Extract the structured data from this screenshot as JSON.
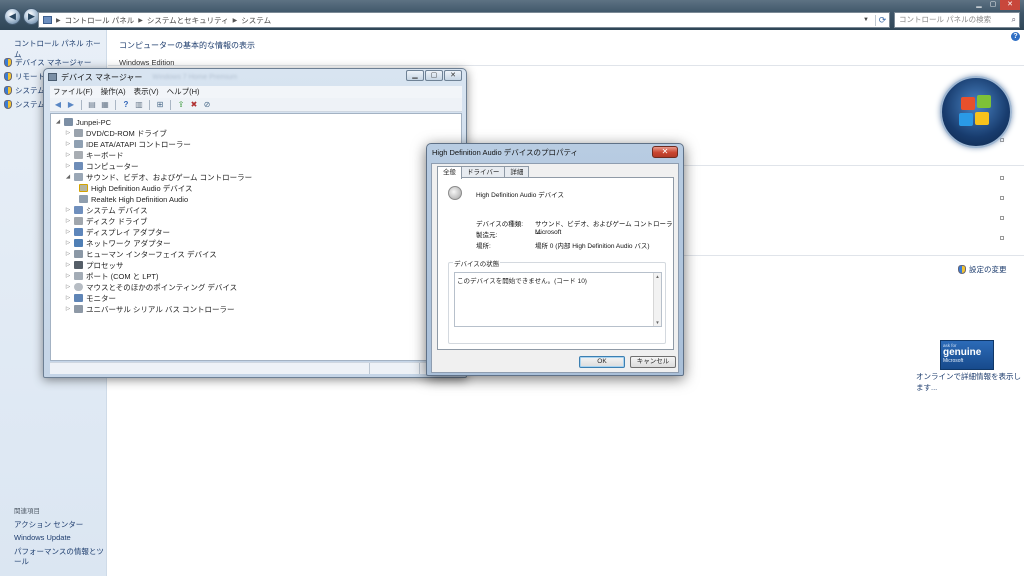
{
  "control_panel": {
    "breadcrumb": [
      "コントロール パネル",
      "システムとセキュリティ",
      "システム"
    ],
    "search_placeholder": "コントロール パネルの検索",
    "sidebar": {
      "home": "コントロール パネル ホーム",
      "links": [
        "デバイス マネージャー",
        "リモート",
        "システム",
        "システム"
      ],
      "related_title": "関連項目",
      "related": [
        "アクション センター",
        "Windows Update",
        "パフォーマンスの情報とツール"
      ]
    },
    "heading": "コンピューターの基本的な情報の表示",
    "edition_label": "Windows Edition",
    "change_settings": "設定の変更",
    "genuine": {
      "line1": "ask for",
      "line2": "genuine",
      "line3": "Microsoft"
    },
    "online_more": "オンラインで詳細情報を表示します..."
  },
  "device_manager": {
    "title": "デバイス マネージャー",
    "blurred_title": "Windows 7 Home Premium",
    "menu": [
      "ファイル(F)",
      "操作(A)",
      "表示(V)",
      "ヘルプ(H)"
    ],
    "root": "Junpei-PC",
    "nodes": [
      "DVD/CD-ROM ドライブ",
      "IDE ATA/ATAPI コントローラー",
      "キーボード",
      "コンピューター",
      "サウンド、ビデオ、およびゲーム コントローラー",
      "High Definition Audio デバイス",
      "Realtek High Definition Audio",
      "システム デバイス",
      "ディスク ドライブ",
      "ディスプレイ アダプター",
      "ネットワーク アダプター",
      "ヒューマン インターフェイス デバイス",
      "プロセッサ",
      "ポート (COM と LPT)",
      "マウスとそのほかのポインティング デバイス",
      "モニター",
      "ユニバーサル シリアル バス コントローラー"
    ]
  },
  "properties": {
    "title": "High Definition Audio デバイスのプロパティ",
    "tabs": [
      "全般",
      "ドライバー",
      "詳細"
    ],
    "device_name": "High Definition Audio デバイス",
    "type_label": "デバイスの種類:",
    "type_value": "サウンド、ビデオ、およびゲーム コントローラー",
    "mfr_label": "製造元:",
    "mfr_value": "Microsoft",
    "loc_label": "場所:",
    "loc_value": "場所 0 (内部 High Definition Audio バス)",
    "status_group": "デバイスの状態",
    "status_text": "このデバイスを開始できません。(コード 10)",
    "ok": "OK",
    "cancel": "キャンセル"
  }
}
